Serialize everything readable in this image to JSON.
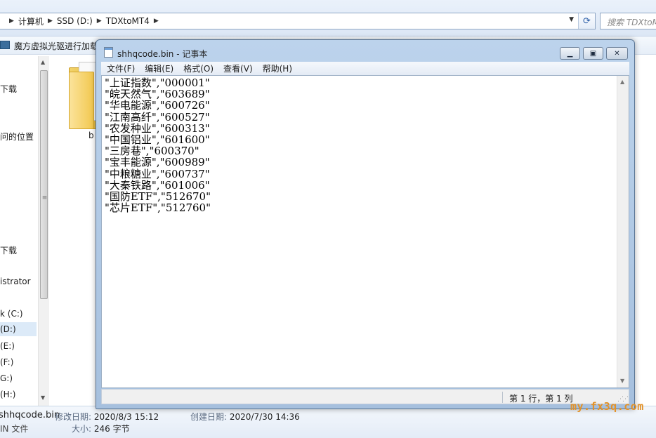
{
  "explorer": {
    "breadcrumbs": [
      "计算机",
      "SSD (D:)",
      "TDXtoMT4"
    ],
    "search_placeholder": "搜索 TDXtoMT4",
    "toolbar_item": "魔方虚拟光驱进行加载",
    "nav_items": [
      {
        "label": "下载",
        "selected": false
      },
      {
        "label": "问的位置",
        "selected": false
      },
      {
        "label": "下载",
        "selected": false
      },
      {
        "label": "istrator",
        "selected": false
      },
      {
        "label": "k (C:)",
        "selected": false
      },
      {
        "label": "(D:)",
        "selected": true
      },
      {
        "label": "(E:)",
        "selected": false
      },
      {
        "label": "(F:)",
        "selected": false
      },
      {
        "label": "G:)",
        "selected": false
      },
      {
        "label": "(H:)",
        "selected": false
      }
    ],
    "folder_label": "b",
    "details": {
      "name": "shhqcode.bin",
      "type": "IN 文件",
      "modified_label": "修改日期:",
      "modified_value": "2020/8/3 15:12",
      "created_label": "创建日期:",
      "created_value": "2020/7/30 14:36",
      "size_label": "大小:",
      "size_value": "246 字节"
    }
  },
  "notepad": {
    "title": "shhqcode.bin - 记事本",
    "menus": [
      "文件(F)",
      "编辑(E)",
      "格式(O)",
      "查看(V)",
      "帮助(H)"
    ],
    "lines": [
      "\"上证指数\",\"000001\"",
      "\"皖天然气\",\"603689\"",
      "\"华电能源\",\"600726\"",
      "\"江南高纤\",\"600527\"",
      "\"农发种业\",\"600313\"",
      "\"中国铝业\",\"601600\"",
      "\"三房巷\",\"600370\"",
      "\"宝丰能源\",\"600989\"",
      "\"中粮糖业\",\"600737\"",
      "\"大秦铁路\",\"601006\"",
      "\"国防ETF\",\"512670\"",
      "\"芯片ETF\",\"512760\""
    ],
    "status_position": "第 1 行，第 1 列"
  },
  "watermark": "my.fx3q.com"
}
